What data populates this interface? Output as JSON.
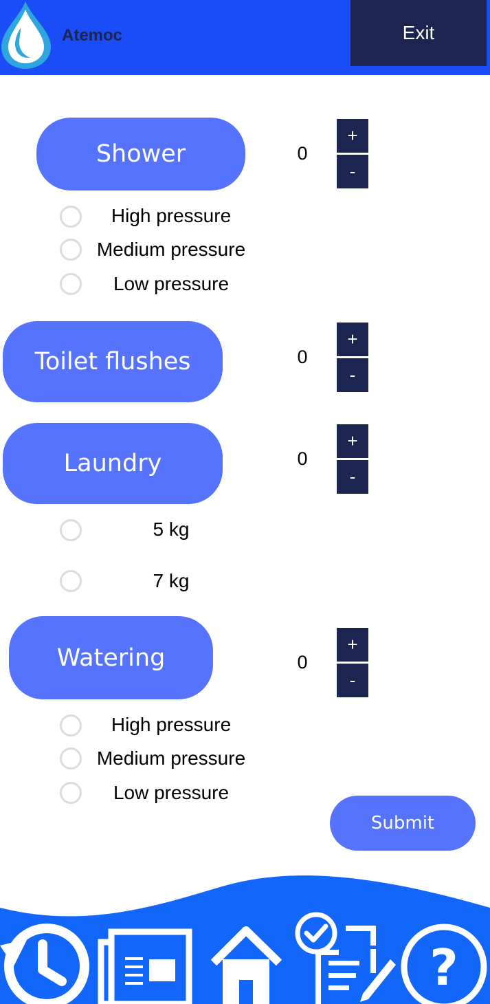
{
  "header": {
    "app_title": "Atemoc",
    "exit_label": "Exit",
    "logo_icon": "water-drop-icon",
    "background": "#1a4cf7"
  },
  "categories": [
    {
      "label": "Shower",
      "count": "0",
      "plus": "+",
      "minus": "-",
      "options": [
        "High pressure",
        "Medium pressure",
        "Low pressure"
      ]
    },
    {
      "label": "Toilet flushes",
      "count": "0",
      "plus": "+",
      "minus": "-"
    },
    {
      "label": "Laundry",
      "count": "0",
      "plus": "+",
      "minus": "-",
      "options": [
        "5 kg",
        "7 kg"
      ]
    },
    {
      "label": "Watering",
      "count": "0",
      "plus": "+",
      "minus": "-",
      "options": [
        "High pressure",
        "Medium pressure",
        "Low pressure"
      ]
    }
  ],
  "submit_label": "Submit",
  "nav": {
    "icons": [
      "history-icon",
      "news-icon",
      "home-icon",
      "tasks-icon",
      "help-icon"
    ]
  },
  "colors": {
    "accent": "#5673fd",
    "dark": "#1b2550",
    "brand_blue": "#1a4cf7"
  }
}
